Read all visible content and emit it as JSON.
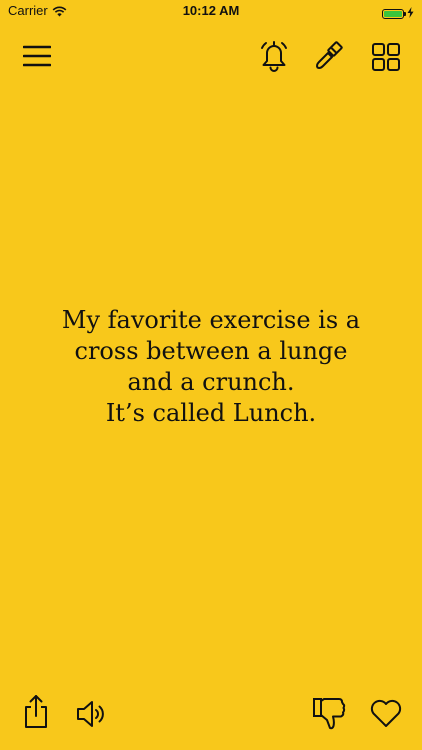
{
  "status_bar": {
    "carrier": "Carrier",
    "time": "10:12 AM",
    "battery_level": 1.0,
    "battery_color": "#3cc43c"
  },
  "toolbar": {
    "menu_icon": "hamburger-menu-icon",
    "notifications_icon": "bell-icon",
    "theme_icon": "paint-brush-icon",
    "categories_icon": "grid-icon"
  },
  "joke": {
    "lines": [
      "My favorite exercise is a",
      "cross between a lunge",
      "and a crunch.",
      "It’s called Lunch."
    ]
  },
  "bottom_bar": {
    "share_icon": "share-icon",
    "audio_icon": "speaker-icon",
    "dislike_icon": "thumbs-down-icon",
    "favorite_icon": "heart-icon"
  },
  "colors": {
    "background": "#F8C81B",
    "foreground": "#111111"
  }
}
